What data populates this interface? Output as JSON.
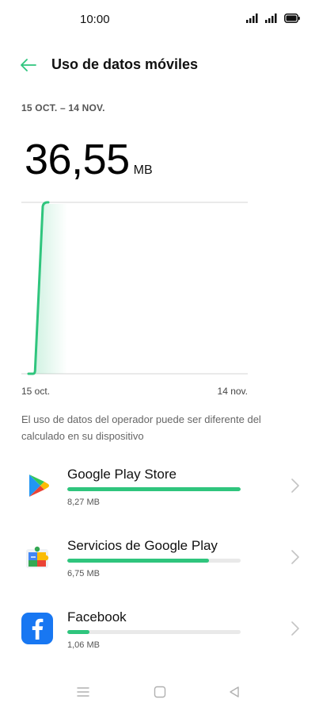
{
  "status_bar": {
    "time": "10:00"
  },
  "header": {
    "title": "Uso de datos móviles"
  },
  "period": {
    "range": "15 OCT. – 14 NOV."
  },
  "usage": {
    "total_value": "36,55",
    "total_unit": "MB"
  },
  "chart_data": {
    "type": "line",
    "x_labels": [
      "15 oct.",
      "14 nov."
    ],
    "x": [
      "15 oct.",
      "16 oct.",
      "14 nov."
    ],
    "values": [
      0,
      36.55,
      36.55
    ],
    "unit": "MB",
    "grid": true
  },
  "disclaimer": "El uso de datos del operador puede ser diferente del calculado en su dispositivo",
  "apps": [
    {
      "name": "Google Play Store",
      "size": "8,27 MB",
      "fraction": 1.0,
      "icon": "google-play-store-icon"
    },
    {
      "name": "Servicios de Google Play",
      "size": "6,75 MB",
      "fraction": 0.816,
      "icon": "google-play-services-icon"
    },
    {
      "name": "Facebook",
      "size": "1,06 MB",
      "fraction": 0.128,
      "icon": "facebook-icon"
    }
  ],
  "colors": {
    "accent": "#2fc57d",
    "facebook": "#1877f2"
  }
}
